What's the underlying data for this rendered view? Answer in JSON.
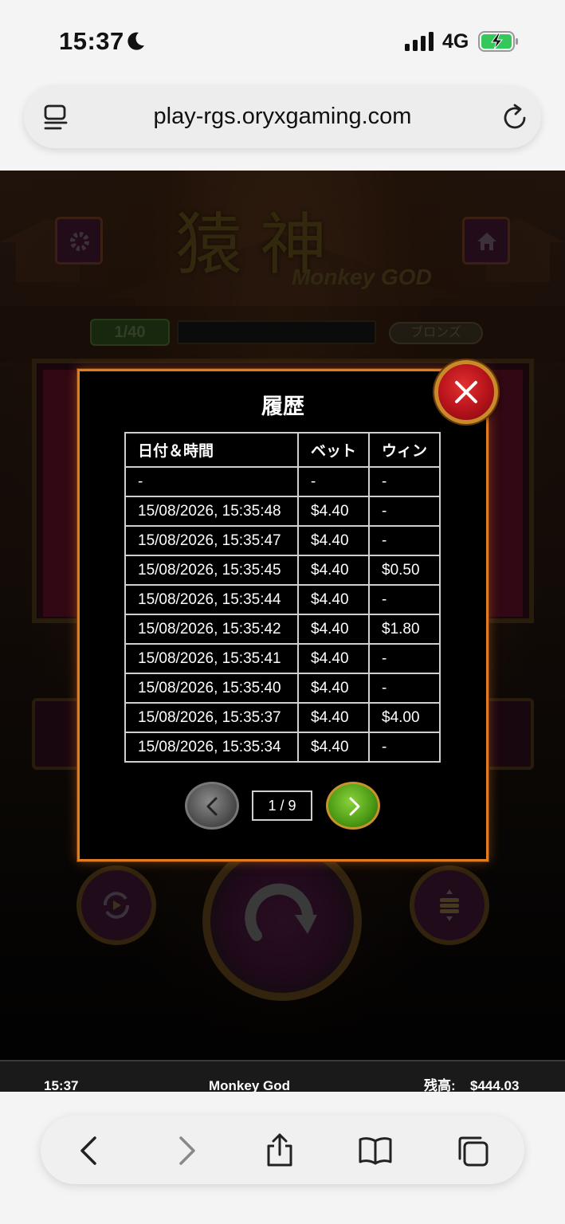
{
  "status_bar": {
    "time": "15:37",
    "network": "4G"
  },
  "browser": {
    "url": "play-rgs.oryxgaming.com"
  },
  "game": {
    "title_cjk": "猿神",
    "subtitle": "Monkey GOD",
    "level": "1/40",
    "rank": "ブロンズ"
  },
  "history": {
    "title": "履歴",
    "columns": [
      "日付＆時間",
      "ベット",
      "ウィン"
    ],
    "rows": [
      {
        "date": "-",
        "bet": "-",
        "win": "-"
      },
      {
        "date": "15/08/2026, 15:35:48",
        "bet": "$4.40",
        "win": "-"
      },
      {
        "date": "15/08/2026, 15:35:47",
        "bet": "$4.40",
        "win": "-"
      },
      {
        "date": "15/08/2026, 15:35:45",
        "bet": "$4.40",
        "win": "$0.50"
      },
      {
        "date": "15/08/2026, 15:35:44",
        "bet": "$4.40",
        "win": "-"
      },
      {
        "date": "15/08/2026, 15:35:42",
        "bet": "$4.40",
        "win": "$1.80"
      },
      {
        "date": "15/08/2026, 15:35:41",
        "bet": "$4.40",
        "win": "-"
      },
      {
        "date": "15/08/2026, 15:35:40",
        "bet": "$4.40",
        "win": "-"
      },
      {
        "date": "15/08/2026, 15:35:37",
        "bet": "$4.40",
        "win": "$4.00"
      },
      {
        "date": "15/08/2026, 15:35:34",
        "bet": "$4.40",
        "win": "-"
      }
    ],
    "page_indicator": "1 / 9"
  },
  "footer": {
    "time": "15:37",
    "game_name": "Monkey God",
    "balance_label": "残高:",
    "balance": "$444.03"
  },
  "colors": {
    "modal_border": "#e07b1f",
    "close_red": "#b4121a",
    "next_green": "#4a9a14"
  },
  "icons": [
    "moon-icon",
    "signal-icon",
    "battery-charging-icon",
    "reader-icon",
    "reload-icon",
    "gear-icon",
    "home-icon",
    "close-icon",
    "chevron-left-icon",
    "chevron-right-icon",
    "spin-icon",
    "autoplay-icon",
    "bet-stack-icon",
    "back-icon",
    "forward-icon",
    "share-icon",
    "bookmarks-icon",
    "tabs-icon"
  ]
}
